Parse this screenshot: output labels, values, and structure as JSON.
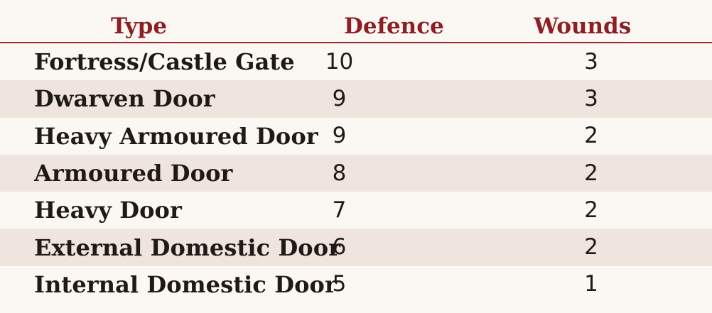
{
  "table": {
    "headers": {
      "type": "Type",
      "defence": "Defence",
      "wounds": "Wounds"
    },
    "rows": [
      {
        "type": "Fortress/Castle Gate",
        "defence": "10",
        "wounds": "3"
      },
      {
        "type": "Dwarven Door",
        "defence": "9",
        "wounds": "3"
      },
      {
        "type": "Heavy Armoured Door",
        "defence": "9",
        "wounds": "2"
      },
      {
        "type": "Armoured Door",
        "defence": "8",
        "wounds": "2"
      },
      {
        "type": "Heavy Door",
        "defence": "7",
        "wounds": "2"
      },
      {
        "type": "External Domestic Door",
        "defence": "6",
        "wounds": "2"
      },
      {
        "type": "Internal Domestic Door",
        "defence": "5",
        "wounds": "1"
      }
    ]
  },
  "colors": {
    "header_text": "#8d1e24",
    "divider": "#9c2a2f",
    "alt_row": "#efe4de",
    "background": "#fbf8f4"
  }
}
